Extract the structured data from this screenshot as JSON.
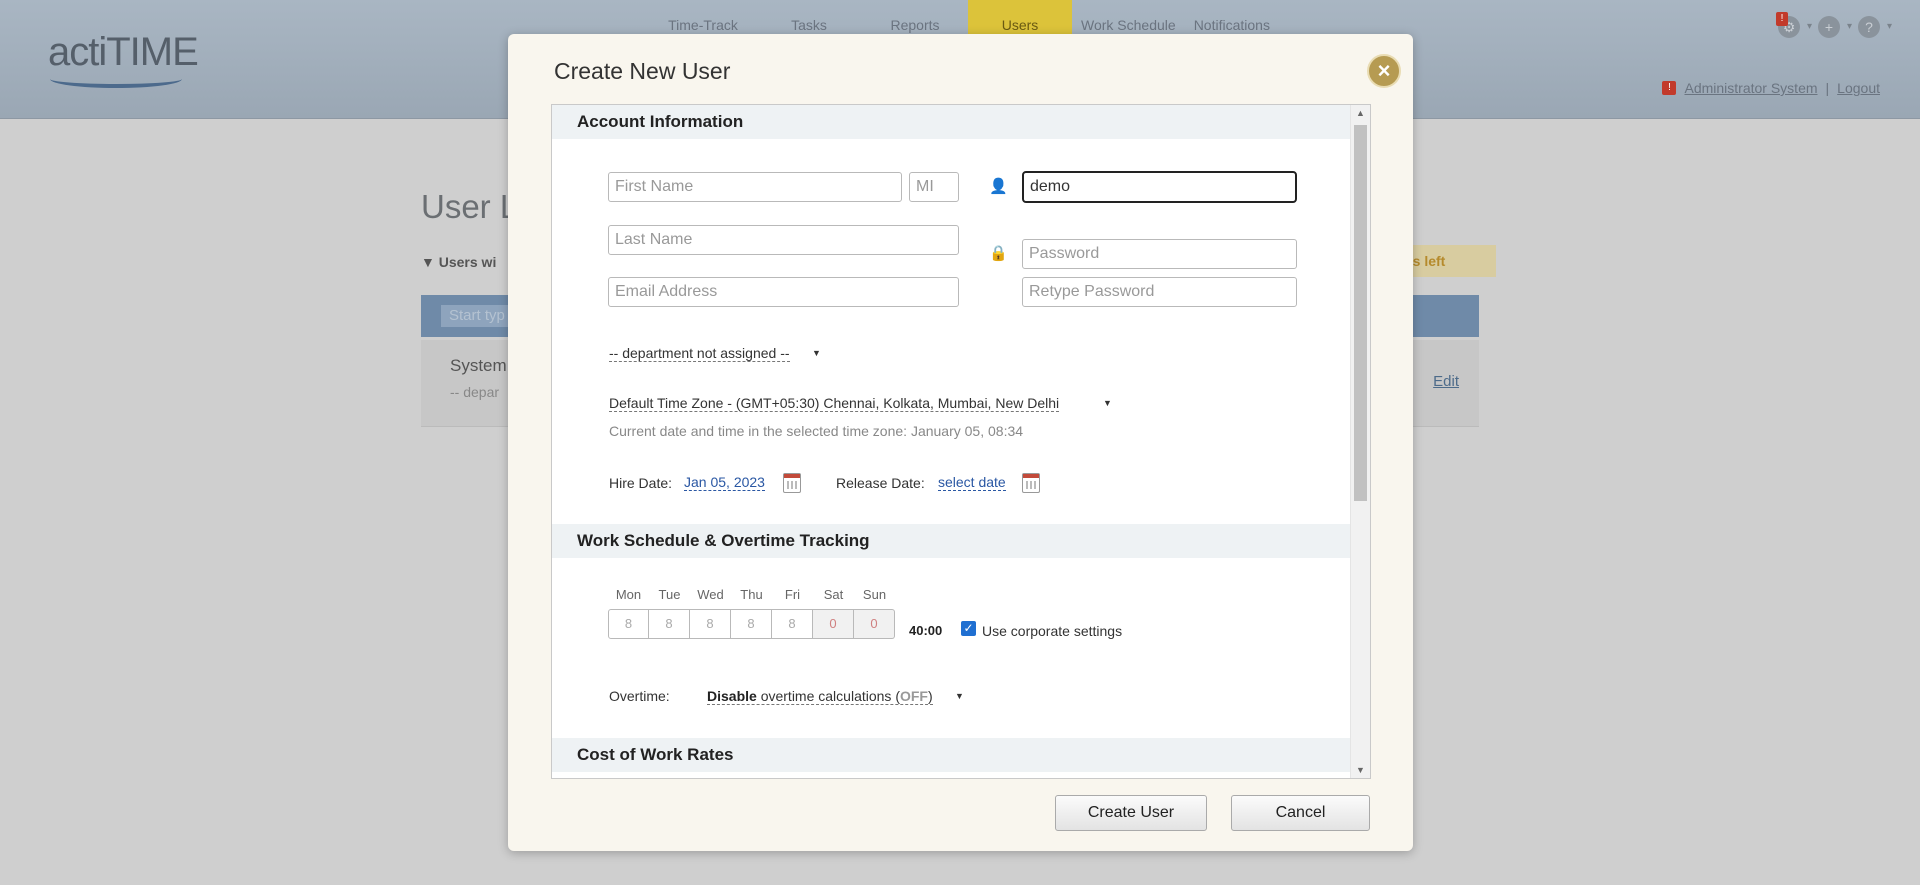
{
  "app": {
    "logo": "actiTIME",
    "nav": [
      "Time-Track",
      "Tasks",
      "Reports",
      "Users",
      "Work Schedule",
      "Notifications"
    ],
    "active_nav": "Users",
    "user_name": "Administrator System",
    "logout": "Logout"
  },
  "background": {
    "title_partial": "User L",
    "filter_partial": "Users wi",
    "search_placeholder": "Start typ",
    "row_name": "System",
    "row_dept": "-- depar",
    "row_edit": "Edit",
    "seats_partial": "ts left"
  },
  "modal": {
    "title": "Create New User",
    "close_symbol": "×",
    "account": {
      "heading": "Account Information",
      "first_name_placeholder": "First Name",
      "mi_placeholder": "MI",
      "username_value": "demo",
      "last_name_placeholder": "Last Name",
      "password_placeholder": "Password",
      "email_placeholder": "Email Address",
      "retype_password_placeholder": "Retype Password",
      "department": "-- department not assigned --",
      "timezone": "Default Time Zone - (GMT+05:30) Chennai, Kolkata, Mumbai, New Delhi",
      "current_time": "Current date and time in the selected time zone: January 05, 08:34",
      "hire_date_label": "Hire Date:",
      "hire_date": "Jan 05, 2023",
      "release_date_label": "Release Date:",
      "release_date": "select date"
    },
    "schedule": {
      "heading": "Work Schedule & Overtime Tracking",
      "days": [
        {
          "name": "Mon",
          "hours": "8",
          "off": false
        },
        {
          "name": "Tue",
          "hours": "8",
          "off": false
        },
        {
          "name": "Wed",
          "hours": "8",
          "off": false
        },
        {
          "name": "Thu",
          "hours": "8",
          "off": false
        },
        {
          "name": "Fri",
          "hours": "8",
          "off": false
        },
        {
          "name": "Sat",
          "hours": "0",
          "off": true
        },
        {
          "name": "Sun",
          "hours": "0",
          "off": true
        }
      ],
      "total": "40:00",
      "corporate_label": "Use corporate settings",
      "corporate_checked": true,
      "overtime_label": "Overtime:",
      "overtime_bold": "Disable",
      "overtime_text": " overtime calculations (",
      "overtime_off": "OFF",
      "overtime_close": ")"
    },
    "cost": {
      "heading": "Cost of Work Rates"
    },
    "buttons": {
      "create": "Create User",
      "cancel": "Cancel"
    }
  }
}
